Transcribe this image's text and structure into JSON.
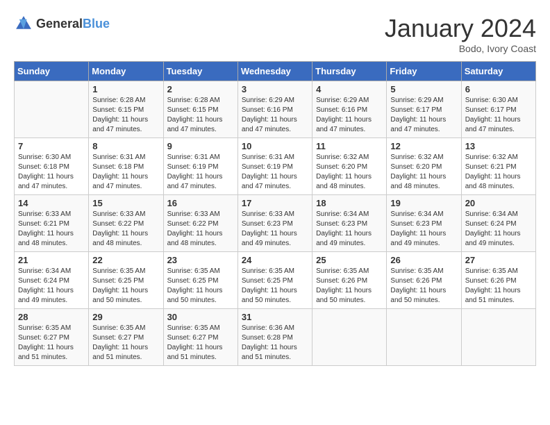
{
  "header": {
    "logo_general": "General",
    "logo_blue": "Blue",
    "month": "January 2024",
    "location": "Bodo, Ivory Coast"
  },
  "weekdays": [
    "Sunday",
    "Monday",
    "Tuesday",
    "Wednesday",
    "Thursday",
    "Friday",
    "Saturday"
  ],
  "weeks": [
    [
      {
        "day": "",
        "sunrise": "",
        "sunset": "",
        "daylight": ""
      },
      {
        "day": "1",
        "sunrise": "Sunrise: 6:28 AM",
        "sunset": "Sunset: 6:15 PM",
        "daylight": "Daylight: 11 hours and 47 minutes."
      },
      {
        "day": "2",
        "sunrise": "Sunrise: 6:28 AM",
        "sunset": "Sunset: 6:15 PM",
        "daylight": "Daylight: 11 hours and 47 minutes."
      },
      {
        "day": "3",
        "sunrise": "Sunrise: 6:29 AM",
        "sunset": "Sunset: 6:16 PM",
        "daylight": "Daylight: 11 hours and 47 minutes."
      },
      {
        "day": "4",
        "sunrise": "Sunrise: 6:29 AM",
        "sunset": "Sunset: 6:16 PM",
        "daylight": "Daylight: 11 hours and 47 minutes."
      },
      {
        "day": "5",
        "sunrise": "Sunrise: 6:29 AM",
        "sunset": "Sunset: 6:17 PM",
        "daylight": "Daylight: 11 hours and 47 minutes."
      },
      {
        "day": "6",
        "sunrise": "Sunrise: 6:30 AM",
        "sunset": "Sunset: 6:17 PM",
        "daylight": "Daylight: 11 hours and 47 minutes."
      }
    ],
    [
      {
        "day": "7",
        "sunrise": "Sunrise: 6:30 AM",
        "sunset": "Sunset: 6:18 PM",
        "daylight": "Daylight: 11 hours and 47 minutes."
      },
      {
        "day": "8",
        "sunrise": "Sunrise: 6:31 AM",
        "sunset": "Sunset: 6:18 PM",
        "daylight": "Daylight: 11 hours and 47 minutes."
      },
      {
        "day": "9",
        "sunrise": "Sunrise: 6:31 AM",
        "sunset": "Sunset: 6:19 PM",
        "daylight": "Daylight: 11 hours and 47 minutes."
      },
      {
        "day": "10",
        "sunrise": "Sunrise: 6:31 AM",
        "sunset": "Sunset: 6:19 PM",
        "daylight": "Daylight: 11 hours and 47 minutes."
      },
      {
        "day": "11",
        "sunrise": "Sunrise: 6:32 AM",
        "sunset": "Sunset: 6:20 PM",
        "daylight": "Daylight: 11 hours and 48 minutes."
      },
      {
        "day": "12",
        "sunrise": "Sunrise: 6:32 AM",
        "sunset": "Sunset: 6:20 PM",
        "daylight": "Daylight: 11 hours and 48 minutes."
      },
      {
        "day": "13",
        "sunrise": "Sunrise: 6:32 AM",
        "sunset": "Sunset: 6:21 PM",
        "daylight": "Daylight: 11 hours and 48 minutes."
      }
    ],
    [
      {
        "day": "14",
        "sunrise": "Sunrise: 6:33 AM",
        "sunset": "Sunset: 6:21 PM",
        "daylight": "Daylight: 11 hours and 48 minutes."
      },
      {
        "day": "15",
        "sunrise": "Sunrise: 6:33 AM",
        "sunset": "Sunset: 6:22 PM",
        "daylight": "Daylight: 11 hours and 48 minutes."
      },
      {
        "day": "16",
        "sunrise": "Sunrise: 6:33 AM",
        "sunset": "Sunset: 6:22 PM",
        "daylight": "Daylight: 11 hours and 48 minutes."
      },
      {
        "day": "17",
        "sunrise": "Sunrise: 6:33 AM",
        "sunset": "Sunset: 6:23 PM",
        "daylight": "Daylight: 11 hours and 49 minutes."
      },
      {
        "day": "18",
        "sunrise": "Sunrise: 6:34 AM",
        "sunset": "Sunset: 6:23 PM",
        "daylight": "Daylight: 11 hours and 49 minutes."
      },
      {
        "day": "19",
        "sunrise": "Sunrise: 6:34 AM",
        "sunset": "Sunset: 6:23 PM",
        "daylight": "Daylight: 11 hours and 49 minutes."
      },
      {
        "day": "20",
        "sunrise": "Sunrise: 6:34 AM",
        "sunset": "Sunset: 6:24 PM",
        "daylight": "Daylight: 11 hours and 49 minutes."
      }
    ],
    [
      {
        "day": "21",
        "sunrise": "Sunrise: 6:34 AM",
        "sunset": "Sunset: 6:24 PM",
        "daylight": "Daylight: 11 hours and 49 minutes."
      },
      {
        "day": "22",
        "sunrise": "Sunrise: 6:35 AM",
        "sunset": "Sunset: 6:25 PM",
        "daylight": "Daylight: 11 hours and 50 minutes."
      },
      {
        "day": "23",
        "sunrise": "Sunrise: 6:35 AM",
        "sunset": "Sunset: 6:25 PM",
        "daylight": "Daylight: 11 hours and 50 minutes."
      },
      {
        "day": "24",
        "sunrise": "Sunrise: 6:35 AM",
        "sunset": "Sunset: 6:25 PM",
        "daylight": "Daylight: 11 hours and 50 minutes."
      },
      {
        "day": "25",
        "sunrise": "Sunrise: 6:35 AM",
        "sunset": "Sunset: 6:26 PM",
        "daylight": "Daylight: 11 hours and 50 minutes."
      },
      {
        "day": "26",
        "sunrise": "Sunrise: 6:35 AM",
        "sunset": "Sunset: 6:26 PM",
        "daylight": "Daylight: 11 hours and 50 minutes."
      },
      {
        "day": "27",
        "sunrise": "Sunrise: 6:35 AM",
        "sunset": "Sunset: 6:26 PM",
        "daylight": "Daylight: 11 hours and 51 minutes."
      }
    ],
    [
      {
        "day": "28",
        "sunrise": "Sunrise: 6:35 AM",
        "sunset": "Sunset: 6:27 PM",
        "daylight": "Daylight: 11 hours and 51 minutes."
      },
      {
        "day": "29",
        "sunrise": "Sunrise: 6:35 AM",
        "sunset": "Sunset: 6:27 PM",
        "daylight": "Daylight: 11 hours and 51 minutes."
      },
      {
        "day": "30",
        "sunrise": "Sunrise: 6:35 AM",
        "sunset": "Sunset: 6:27 PM",
        "daylight": "Daylight: 11 hours and 51 minutes."
      },
      {
        "day": "31",
        "sunrise": "Sunrise: 6:36 AM",
        "sunset": "Sunset: 6:28 PM",
        "daylight": "Daylight: 11 hours and 51 minutes."
      },
      {
        "day": "",
        "sunrise": "",
        "sunset": "",
        "daylight": ""
      },
      {
        "day": "",
        "sunrise": "",
        "sunset": "",
        "daylight": ""
      },
      {
        "day": "",
        "sunrise": "",
        "sunset": "",
        "daylight": ""
      }
    ]
  ]
}
